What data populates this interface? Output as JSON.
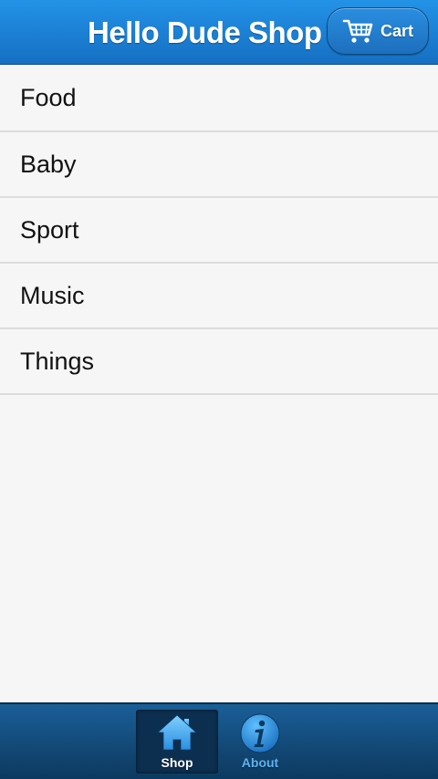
{
  "header": {
    "title": "Hello Dude Shop",
    "cart_label": "Cart",
    "cart_icon": "shopping-cart-icon"
  },
  "categories": [
    {
      "label": "Food"
    },
    {
      "label": "Baby"
    },
    {
      "label": "Sport"
    },
    {
      "label": "Music"
    },
    {
      "label": "Things"
    }
  ],
  "tabbar": {
    "tabs": [
      {
        "label": "Shop",
        "icon": "home-icon",
        "selected": true
      },
      {
        "label": "About",
        "icon": "info-icon",
        "selected": false
      }
    ]
  },
  "colors": {
    "header_blue": "#1b7fd3",
    "tabbar_blue": "#124874",
    "list_background": "#f6f6f6",
    "about_label": "#5fb4f0"
  }
}
